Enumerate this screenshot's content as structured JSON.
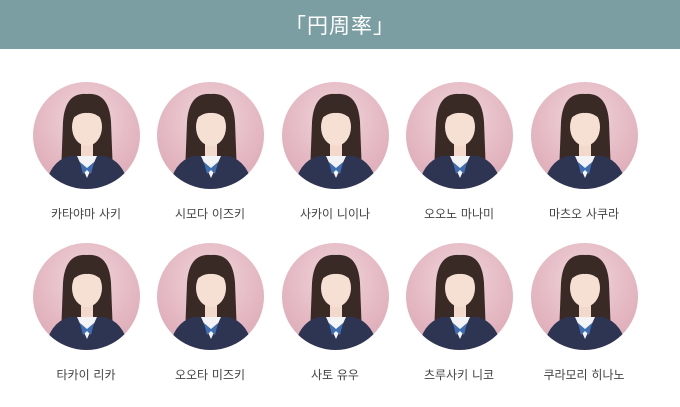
{
  "header": {
    "title": "「円周率」"
  },
  "members": [
    {
      "name": "카타야마 사키"
    },
    {
      "name": "시모다 이즈키"
    },
    {
      "name": "사카이 니이나"
    },
    {
      "name": "오오노 마나미"
    },
    {
      "name": "마츠오 사쿠라"
    },
    {
      "name": "타카이 리카"
    },
    {
      "name": "오오타 미즈키"
    },
    {
      "name": "사토 유우"
    },
    {
      "name": "츠루사키 니코"
    },
    {
      "name": "쿠라모리 히나노"
    }
  ],
  "colors": {
    "header_bg": "#7b9ea2",
    "avatar_bg": "#e4b8c2",
    "uniform": "#2e3552",
    "ribbon": "#3f6fb0"
  }
}
